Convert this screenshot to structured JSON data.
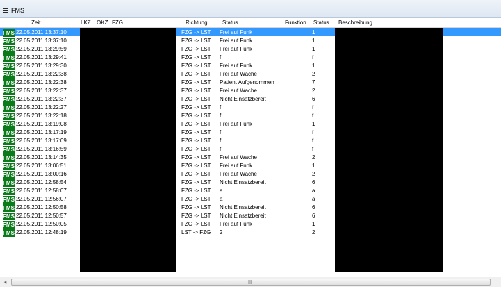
{
  "window": {
    "title": "FMS",
    "menu_icon": "hamburger-icon"
  },
  "columns": [
    "Zeit",
    "LKZ",
    "OKZ",
    "FZG",
    "Richtung",
    "Status",
    "Funktion",
    "Status",
    "Beschreibung"
  ],
  "badge_label": "FMS",
  "badge_color": "#0b7a1a",
  "selection_color": "#3399ff",
  "rows": [
    {
      "zeit": "22.05.2011 13:37:10",
      "richtung": "FZG -> LST",
      "status_text": "Frei auf Funk",
      "status_code": "1"
    },
    {
      "zeit": "22.05.2011 13:37:10",
      "richtung": "FZG -> LST",
      "status_text": "Frei auf Funk",
      "status_code": "1"
    },
    {
      "zeit": "22.05.2011 13:29:59",
      "richtung": "FZG -> LST",
      "status_text": "Frei auf Funk",
      "status_code": "1"
    },
    {
      "zeit": "22.05.2011 13:29:41",
      "richtung": "FZG -> LST",
      "status_text": "f",
      "status_code": "f"
    },
    {
      "zeit": "22.05.2011 13:29:30",
      "richtung": "FZG -> LST",
      "status_text": "Frei auf Funk",
      "status_code": "1"
    },
    {
      "zeit": "22.05.2011 13:22:38",
      "richtung": "FZG -> LST",
      "status_text": "Frei auf Wache",
      "status_code": "2"
    },
    {
      "zeit": "22.05.2011 13:22:38",
      "richtung": "FZG -> LST",
      "status_text": "Patient Aufgenommen",
      "status_code": "7"
    },
    {
      "zeit": "22.05.2011 13:22:37",
      "richtung": "FZG -> LST",
      "status_text": "Frei auf Wache",
      "status_code": "2"
    },
    {
      "zeit": "22.05.2011 13:22:37",
      "richtung": "FZG -> LST",
      "status_text": "Nicht Einsatzbereit",
      "status_code": "6"
    },
    {
      "zeit": "22.05.2011 13:22:27",
      "richtung": "FZG -> LST",
      "status_text": "f",
      "status_code": "f"
    },
    {
      "zeit": "22.05.2011 13:22:18",
      "richtung": "FZG -> LST",
      "status_text": "f",
      "status_code": "f"
    },
    {
      "zeit": "22.05.2011 13:19:08",
      "richtung": "FZG -> LST",
      "status_text": "Frei auf Funk",
      "status_code": "1"
    },
    {
      "zeit": "22.05.2011 13:17:19",
      "richtung": "FZG -> LST",
      "status_text": "f",
      "status_code": "f"
    },
    {
      "zeit": "22.05.2011 13:17:09",
      "richtung": "FZG -> LST",
      "status_text": "f",
      "status_code": "f"
    },
    {
      "zeit": "22.05.2011 13:16:59",
      "richtung": "FZG -> LST",
      "status_text": "f",
      "status_code": "f"
    },
    {
      "zeit": "22.05.2011 13:14:35",
      "richtung": "FZG -> LST",
      "status_text": "Frei auf Wache",
      "status_code": "2"
    },
    {
      "zeit": "22.05.2011 13:06:51",
      "richtung": "FZG -> LST",
      "status_text": "Frei auf Funk",
      "status_code": "1"
    },
    {
      "zeit": "22.05.2011 13:00:16",
      "richtung": "FZG -> LST",
      "status_text": "Frei auf Wache",
      "status_code": "2"
    },
    {
      "zeit": "22.05.2011 12:58:54",
      "richtung": "FZG -> LST",
      "status_text": "Nicht Einsatzbereit",
      "status_code": "6"
    },
    {
      "zeit": "22.05.2011 12:58:07",
      "richtung": "FZG -> LST",
      "status_text": "a",
      "status_code": "a"
    },
    {
      "zeit": "22.05.2011 12:56:07",
      "richtung": "FZG -> LST",
      "status_text": "a",
      "status_code": "a"
    },
    {
      "zeit": "22.05.2011 12:50:58",
      "richtung": "FZG -> LST",
      "status_text": "Nicht Einsatzbereit",
      "status_code": "6"
    },
    {
      "zeit": "22.05.2011 12:50:57",
      "richtung": "FZG -> LST",
      "status_text": "Nicht Einsatzbereit",
      "status_code": "6"
    },
    {
      "zeit": "22.05.2011 12:50:05",
      "richtung": "FZG -> LST",
      "status_text": "Frei auf Funk",
      "status_code": "1"
    },
    {
      "zeit": "22.05.2011 12:48:19",
      "richtung": "LST -> FZG",
      "status_text": "2",
      "status_code": "2"
    }
  ],
  "scrollbar": {
    "left_arrow": "◂",
    "grip": "III"
  }
}
